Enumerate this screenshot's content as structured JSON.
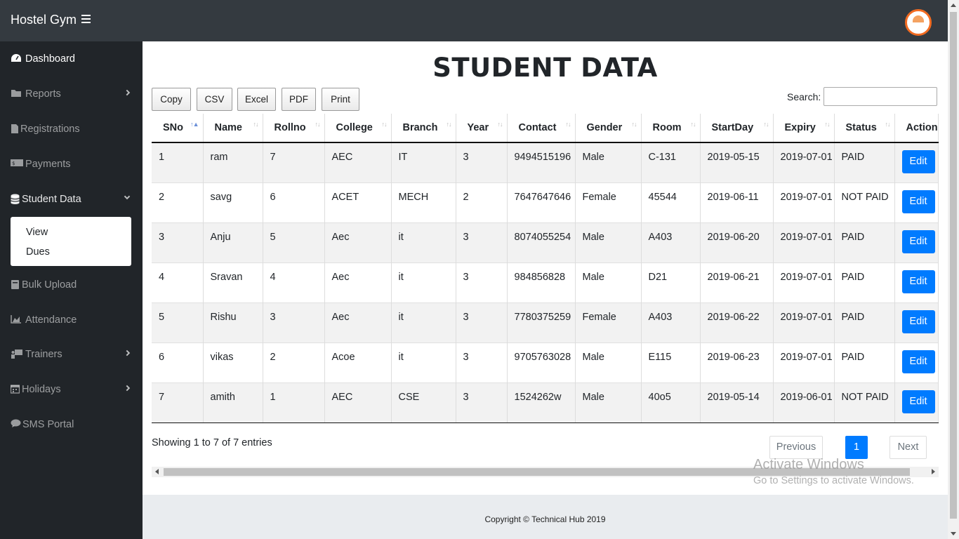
{
  "app": {
    "brand": "Hostel Gym"
  },
  "sidebar": {
    "items": [
      {
        "label": "Dashboard",
        "icon": "tachometer-icon"
      },
      {
        "label": "Reports",
        "icon": "folder-icon"
      },
      {
        "label": "Registrations",
        "icon": "file-icon"
      },
      {
        "label": "Payments",
        "icon": "money-icon"
      },
      {
        "label": "Student Data",
        "icon": "database-icon"
      },
      {
        "label": "Bulk Upload",
        "icon": "book-icon"
      },
      {
        "label": "Attendance",
        "icon": "area-chart-icon"
      },
      {
        "label": "Trainers",
        "icon": "chalkboard-icon"
      },
      {
        "label": "Holidays",
        "icon": "calendar-icon"
      },
      {
        "label": "SMS Portal",
        "icon": "comment-icon"
      }
    ],
    "submenu": [
      "View",
      "Dues"
    ]
  },
  "main": {
    "title": "STUDENT DATA",
    "export_buttons": [
      "Copy",
      "CSV",
      "Excel",
      "PDF",
      "Print"
    ],
    "search_label": "Search:",
    "columns": [
      "SNo",
      "Name",
      "Rollno",
      "College",
      "Branch",
      "Year",
      "Contact",
      "Gender",
      "Room",
      "StartDay",
      "Expiry",
      "Status",
      "Action"
    ],
    "rows": [
      {
        "sno": "1",
        "name": "ram",
        "rollno": "7",
        "college": "AEC",
        "branch": "IT",
        "year": "3",
        "contact": "9494515196",
        "gender": "Male",
        "room": "C-131",
        "start": "2019-05-15",
        "expiry": "2019-07-01",
        "status": "PAID",
        "action": "Edit"
      },
      {
        "sno": "2",
        "name": "savg",
        "rollno": "6",
        "college": "ACET",
        "branch": "MECH",
        "year": "2",
        "contact": "7647647646",
        "gender": "Female",
        "room": "45544",
        "start": "2019-06-11",
        "expiry": "2019-07-01",
        "status": "NOT PAID",
        "action": "Edit"
      },
      {
        "sno": "3",
        "name": "Anju",
        "rollno": "5",
        "college": "Aec",
        "branch": "it",
        "year": "3",
        "contact": "8074055254",
        "gender": "Male",
        "room": "A403",
        "start": "2019-06-20",
        "expiry": "2019-07-01",
        "status": "PAID",
        "action": "Edit"
      },
      {
        "sno": "4",
        "name": "Sravan",
        "rollno": "4",
        "college": "Aec",
        "branch": "it",
        "year": "3",
        "contact": "984856828",
        "gender": "Male",
        "room": "D21",
        "start": "2019-06-21",
        "expiry": "2019-07-01",
        "status": "PAID",
        "action": "Edit"
      },
      {
        "sno": "5",
        "name": "Rishu",
        "rollno": "3",
        "college": "Aec",
        "branch": "it",
        "year": "3",
        "contact": "7780375259",
        "gender": "Female",
        "room": "A403",
        "start": "2019-06-22",
        "expiry": "2019-07-01",
        "status": "PAID",
        "action": "Edit"
      },
      {
        "sno": "6",
        "name": "vikas",
        "rollno": "2",
        "college": "Acoe",
        "branch": "it",
        "year": "3",
        "contact": "9705763028",
        "gender": "Male",
        "room": "E115",
        "start": "2019-06-23",
        "expiry": "2019-07-01",
        "status": "PAID",
        "action": "Edit"
      },
      {
        "sno": "7",
        "name": "amith",
        "rollno": "1",
        "college": "AEC",
        "branch": "CSE",
        "year": "3",
        "contact": "1524262w",
        "gender": "Male",
        "room": "40o5",
        "start": "2019-05-14",
        "expiry": "2019-06-01",
        "status": "NOT PAID",
        "action": "Edit"
      }
    ],
    "info": "Showing 1 to 7 of 7 entries",
    "pagination": {
      "previous": "Previous",
      "current": "1",
      "next": "Next"
    }
  },
  "watermark": {
    "line1": "Activate Windows",
    "line2": "Go to Settings to activate Windows."
  },
  "footer": "Copyright © Technical Hub 2019",
  "colors": {
    "topbar": "#343a40",
    "sidebar": "#212529",
    "primary": "#007bff",
    "logo_ring": "#f26b21"
  }
}
